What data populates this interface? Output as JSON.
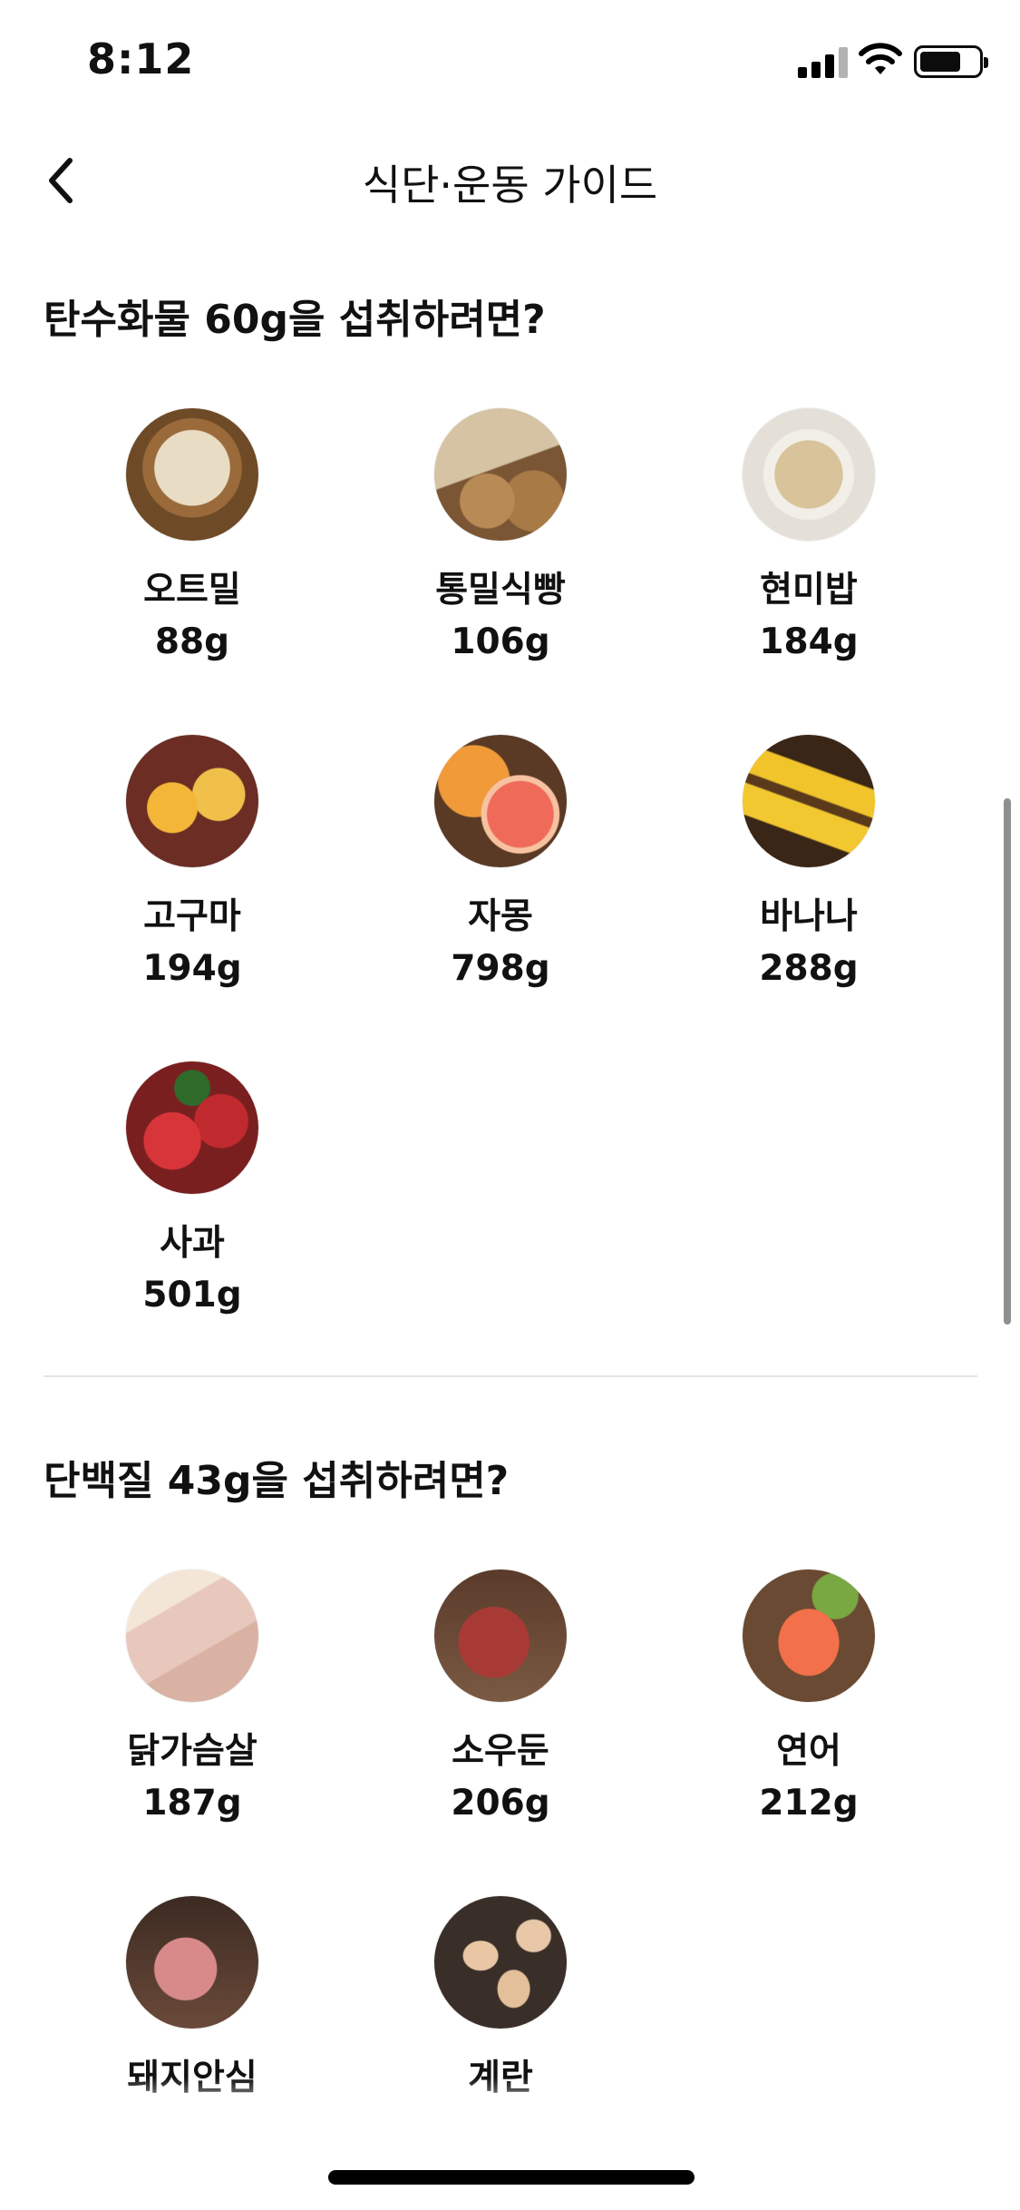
{
  "status_bar": {
    "time": "8:12"
  },
  "nav": {
    "title": "식단·운동 가이드"
  },
  "sections": [
    {
      "title": "탄수화물 60g을 섭취하려면?",
      "items": [
        {
          "name": "오트밀",
          "amount": "88g",
          "image": "oatmeal"
        },
        {
          "name": "통밀식빵",
          "amount": "106g",
          "image": "whole-wheat-bread"
        },
        {
          "name": "현미밥",
          "amount": "184g",
          "image": "brown-rice"
        },
        {
          "name": "고구마",
          "amount": "194g",
          "image": "sweet-potato"
        },
        {
          "name": "자몽",
          "amount": "798g",
          "image": "grapefruit"
        },
        {
          "name": "바나나",
          "amount": "288g",
          "image": "banana"
        },
        {
          "name": "사과",
          "amount": "501g",
          "image": "apple"
        }
      ]
    },
    {
      "title": "단백질 43g을 섭취하려면?",
      "items": [
        {
          "name": "닭가슴살",
          "amount": "187g",
          "image": "chicken-breast"
        },
        {
          "name": "소우둔",
          "amount": "206g",
          "image": "beef-round"
        },
        {
          "name": "연어",
          "amount": "212g",
          "image": "salmon"
        },
        {
          "name": "돼지안심",
          "amount": "",
          "image": "pork-tenderloin"
        },
        {
          "name": "계란",
          "amount": "",
          "image": "egg"
        }
      ]
    }
  ]
}
